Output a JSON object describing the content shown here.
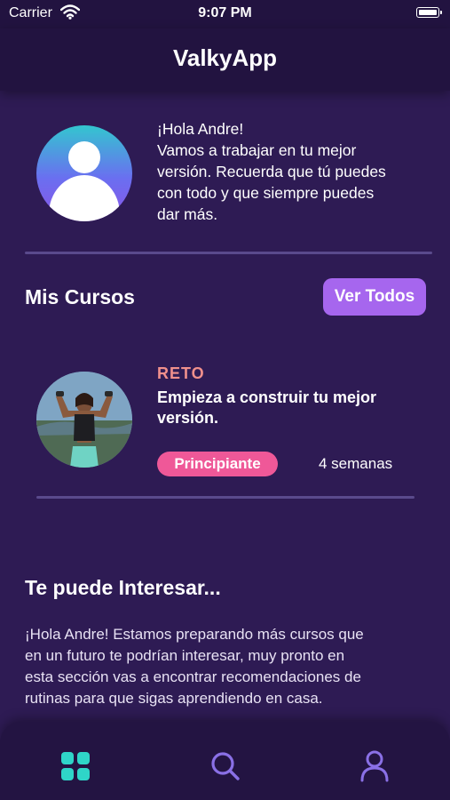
{
  "status_bar": {
    "carrier": "Carrier",
    "time": "9:07 PM",
    "icons": [
      "wifi-icon",
      "battery-icon"
    ]
  },
  "nav": {
    "title": "ValkyApp"
  },
  "profile": {
    "greeting_lines": [
      "¡Hola Andre!",
      "Vamos a trabajar en tu mejor",
      "versión. Recuerda que tú puedes",
      "con todo y que siempre puedes",
      "dar más."
    ]
  },
  "courses_section": {
    "title": "Mis Cursos",
    "see_all_label": "Ver Todos",
    "course": {
      "tag": "RETO",
      "title_lines": [
        "Empieza a construir tu mejor",
        "versión."
      ],
      "level": "Principiante",
      "duration": "4 semanas"
    }
  },
  "interest_section": {
    "title": "Te puede Interesar...",
    "body_lines": [
      "¡Hola Andre! Estamos preparando más cursos que",
      "en un futuro te podrían interesar, muy pronto en",
      "esta sección vas a encontrar recomendaciones de",
      "rutinas para que sigas aprendiendo en casa."
    ]
  },
  "tab_bar": {
    "tabs": [
      {
        "icon": "grid-icon",
        "active": true
      },
      {
        "icon": "search-icon",
        "active": false
      },
      {
        "icon": "profile-icon",
        "active": false
      }
    ]
  },
  "colors": {
    "background": "#2e1b54",
    "bar": "#221340",
    "accent_purple": "#a666ee",
    "badge_pink": "#ef5898",
    "tag_salmon": "#f0908c",
    "active_tab": "#2fd5c8",
    "inactive_tab": "#8a70e6"
  }
}
